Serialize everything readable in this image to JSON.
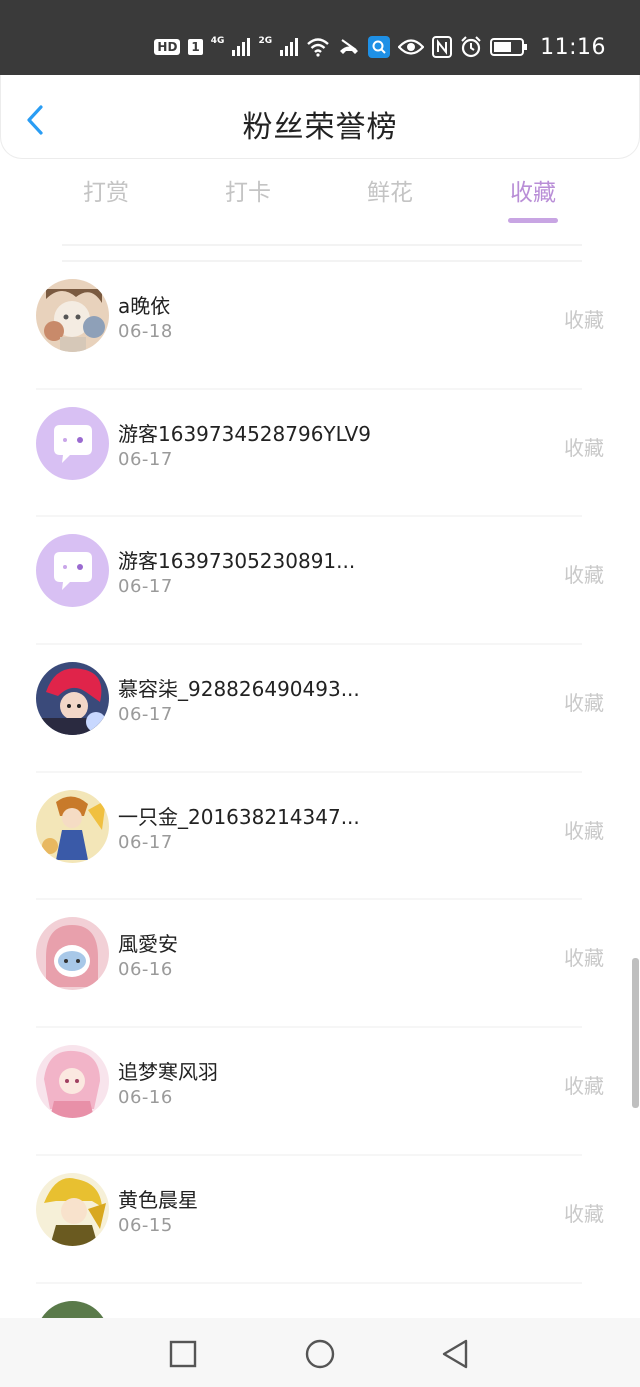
{
  "status_bar": {
    "hd": "HD",
    "sim": "1",
    "net1": "4G",
    "net2": "2G",
    "time": "11:16"
  },
  "header": {
    "title": "粉丝荣誉榜",
    "back_icon": "chevron-left-icon"
  },
  "tabs": [
    {
      "label": "打赏",
      "active": false
    },
    {
      "label": "打卡",
      "active": false
    },
    {
      "label": "鲜花",
      "active": false
    },
    {
      "label": "收藏",
      "active": true
    }
  ],
  "colors": {
    "accent": "#b98ed7",
    "tab_inactive": "#c4c4c4",
    "placeholder_avatar": "#d8c0f3"
  },
  "list": [
    {
      "name": "a晚依",
      "date": "06-18",
      "type": "收藏",
      "avatar": "anime-group"
    },
    {
      "name": "游客1639734528796YLV9",
      "date": "06-17",
      "type": "收藏",
      "avatar": "default-chat"
    },
    {
      "name": "游客16397305230891...",
      "date": "06-17",
      "type": "收藏",
      "avatar": "default-chat"
    },
    {
      "name": "慕容柒_928826490493...",
      "date": "06-17",
      "type": "收藏",
      "avatar": "anime-red-hair"
    },
    {
      "name": "一只金_201638214347...",
      "date": "06-17",
      "type": "收藏",
      "avatar": "anime-yellow"
    },
    {
      "name": "風愛安",
      "date": "06-16",
      "type": "收藏",
      "avatar": "anime-pink-hood"
    },
    {
      "name": "追梦寒风羽",
      "date": "06-16",
      "type": "收藏",
      "avatar": "anime-pink-girl"
    },
    {
      "name": "黄色晨星",
      "date": "06-15",
      "type": "收藏",
      "avatar": "anime-golden"
    }
  ],
  "nav": {
    "recent_icon": "square-icon",
    "home_icon": "circle-icon",
    "back_icon": "triangle-back-icon"
  }
}
